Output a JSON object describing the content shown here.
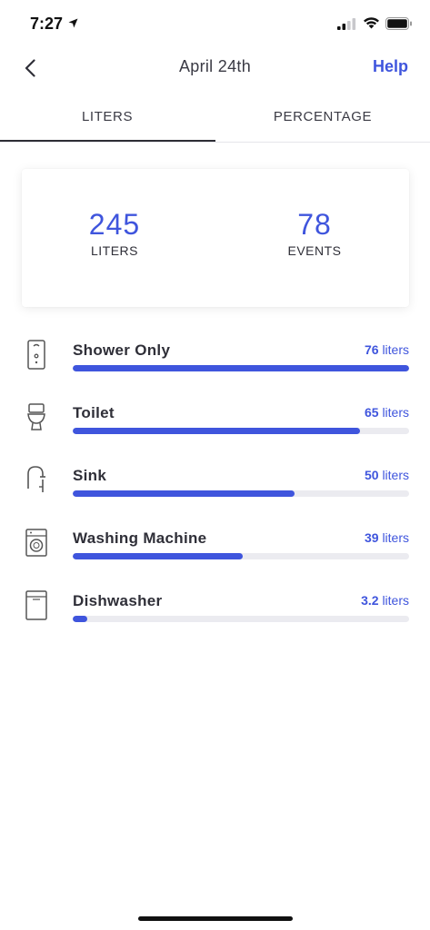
{
  "status": {
    "time": "7:27"
  },
  "nav": {
    "title": "April 24th",
    "help_label": "Help"
  },
  "tabs": [
    {
      "label": "LITERS",
      "active": true
    },
    {
      "label": "PERCENTAGE",
      "active": false
    }
  ],
  "summary": {
    "liters_value": "245",
    "liters_label": "LITERS",
    "events_value": "78",
    "events_label": "EVENTS"
  },
  "fixtures": [
    {
      "name": "Shower Only",
      "value": "76",
      "unit": "liters",
      "fraction": 1.0,
      "icon": "shower-icon"
    },
    {
      "name": "Toilet",
      "value": "65",
      "unit": "liters",
      "fraction": 0.855,
      "icon": "toilet-icon"
    },
    {
      "name": "Sink",
      "value": "50",
      "unit": "liters",
      "fraction": 0.66,
      "icon": "faucet-icon"
    },
    {
      "name": "Washing Machine",
      "value": "39",
      "unit": "liters",
      "fraction": 0.505,
      "icon": "washing-machine-icon"
    },
    {
      "name": "Dishwasher",
      "value": "3.2",
      "unit": "liters",
      "fraction": 0.042,
      "icon": "dishwasher-icon"
    }
  ],
  "colors": {
    "accent": "#3f55dd",
    "track": "#ebebf0",
    "text": "#2f2f38"
  }
}
